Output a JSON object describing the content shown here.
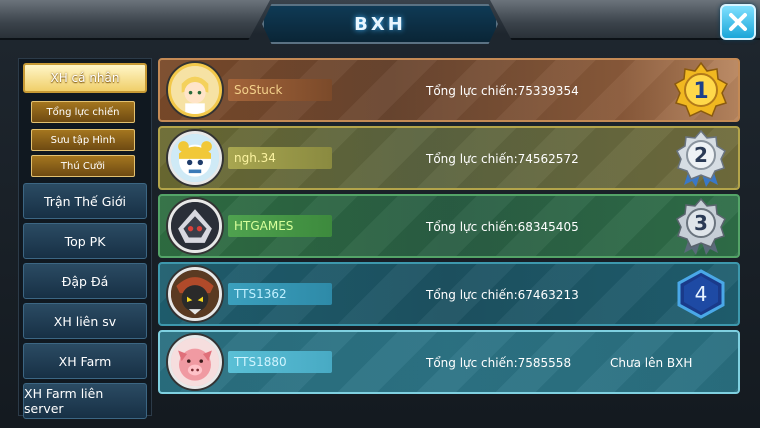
{
  "title": "BXH",
  "sidebar": {
    "main": "XH cá nhân",
    "subs": [
      "Tổng lực chiến",
      "Sưu tập Hình",
      "Thú Cưỡi"
    ],
    "buttons": [
      "Trận Thế Giới",
      "Top PK",
      "Đập Đá",
      "XH liên sv",
      "XH Farm",
      "XH Farm liên server"
    ]
  },
  "ranking": [
    {
      "rank": "1",
      "name": "SoStuck",
      "power": "Tổng lực chiến:75339354",
      "medal": "gold"
    },
    {
      "rank": "2",
      "name": "ngh.34",
      "power": "Tổng lực chiến:74562572",
      "medal": "silver"
    },
    {
      "rank": "3",
      "name": "HTGAMES",
      "power": "Tổng lực chiến:68345405",
      "medal": "bronze"
    },
    {
      "rank": "4",
      "name": "TTS1362",
      "power": "Tổng lực chiến:67463213",
      "medal": "hexagon"
    },
    {
      "name": "TTS1880",
      "power": "Tổng lực chiến:7585558",
      "status": "Chưa lên BXH"
    }
  ],
  "colors": {
    "accent": "#1aa6d8",
    "gold": "#f2c84a"
  }
}
